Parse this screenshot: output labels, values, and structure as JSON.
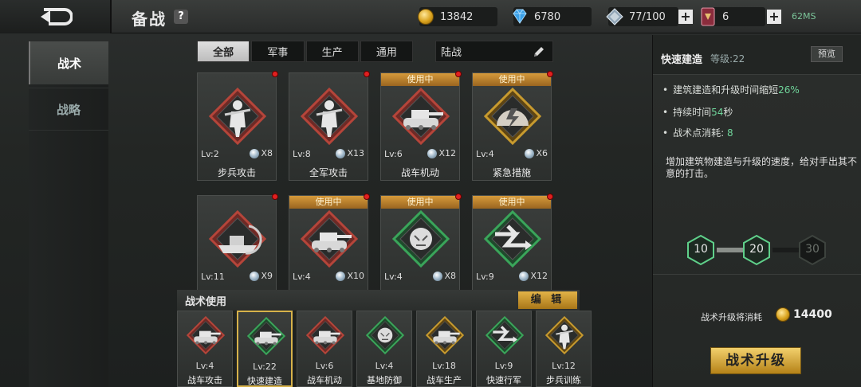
{
  "header": {
    "title": "备战",
    "help_glyph": "?",
    "resources": [
      {
        "icon": "gold-coin-icon",
        "value": "13842"
      },
      {
        "icon": "diamond-icon",
        "value": "6780"
      },
      {
        "icon": "steel-icon",
        "value": "77/100"
      },
      {
        "icon": "card-pack-icon",
        "value": "6"
      }
    ],
    "ping": "62MS"
  },
  "sidebar": {
    "items": [
      {
        "label": "战术",
        "active": true
      },
      {
        "label": "战略",
        "active": false
      }
    ]
  },
  "tabs": [
    {
      "label": "全部",
      "active": true
    },
    {
      "label": "军事"
    },
    {
      "label": "生产"
    },
    {
      "label": "通用"
    }
  ],
  "filter": {
    "value": "陆战"
  },
  "in_use_label": "使用中",
  "cards": [
    {
      "name": "步兵攻击",
      "level": "Lv:2",
      "count": "X8",
      "in_use": false,
      "tone": "red"
    },
    {
      "name": "全军攻击",
      "level": "Lv:8",
      "count": "X13",
      "in_use": false,
      "tone": "red"
    },
    {
      "name": "战车机动",
      "level": "Lv:6",
      "count": "X12",
      "in_use": true,
      "tone": "red"
    },
    {
      "name": "紧急措施",
      "level": "Lv:4",
      "count": "X6",
      "in_use": true,
      "tone": "gold"
    },
    {
      "name": "",
      "level": "Lv:11",
      "count": "X9",
      "in_use": false,
      "tone": "red"
    },
    {
      "name": "",
      "level": "Lv:4",
      "count": "X10",
      "in_use": true,
      "tone": "red"
    },
    {
      "name": "",
      "level": "Lv:4",
      "count": "X8",
      "in_use": true,
      "tone": "green"
    },
    {
      "name": "",
      "level": "Lv:9",
      "count": "X12",
      "in_use": true,
      "tone": "green"
    }
  ],
  "usage_bar": {
    "label": "战术使用",
    "edit_label": "编 辑"
  },
  "slots": [
    {
      "name": "战车攻击",
      "level": "Lv:4",
      "tone": "red"
    },
    {
      "name": "快速建造",
      "level": "Lv:22",
      "tone": "green",
      "selected": true
    },
    {
      "name": "战车机动",
      "level": "Lv:6",
      "tone": "red"
    },
    {
      "name": "基地防御",
      "level": "Lv:4",
      "tone": "green"
    },
    {
      "name": "战车生产",
      "level": "Lv:18",
      "tone": "gold"
    },
    {
      "name": "快速行军",
      "level": "Lv:9",
      "tone": "green"
    },
    {
      "name": "步兵训练",
      "level": "Lv:12",
      "tone": "gold"
    }
  ],
  "detail": {
    "name": "快速建造",
    "level_text": "等级:22",
    "preview_label": "预览",
    "b1_pre": "建筑建造和升级时间缩短",
    "b1_val": "26%",
    "b2_pre": "持续时间",
    "b2_val": "54",
    "b2_post": "秒",
    "b3_pre": "战术点消耗: ",
    "b3_val": "8",
    "description": "增加建筑物建造与升级的速度，给对手出其不意的打击。",
    "milestones": [
      "10",
      "20",
      "30"
    ],
    "cost_label": "战术升级将消耗",
    "cost_value": "14400",
    "upgrade_label": "战术升级"
  },
  "colors": {
    "red": "#b5453a",
    "green": "#3aa55a",
    "gold": "#c79a2e",
    "in_use_badge": "#c98a2e",
    "accent_text": "#6fd49a"
  }
}
